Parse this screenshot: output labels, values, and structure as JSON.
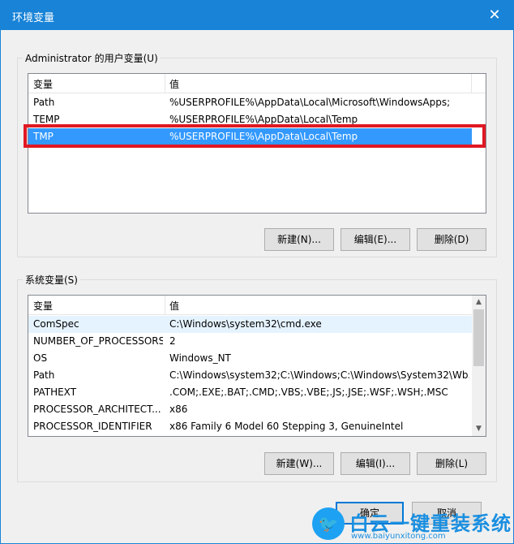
{
  "window": {
    "title": "环境变量",
    "close_glyph": "✕"
  },
  "user_vars": {
    "label": "Administrator 的用户变量(U)",
    "columns": [
      "变量",
      "值"
    ],
    "rows": [
      {
        "name": "Path",
        "value": "%USERPROFILE%\\AppData\\Local\\Microsoft\\WindowsApps;"
      },
      {
        "name": "TEMP",
        "value": "%USERPROFILE%\\AppData\\Local\\Temp"
      },
      {
        "name": "TMP",
        "value": "%USERPROFILE%\\AppData\\Local\\Temp",
        "selected": true
      }
    ],
    "buttons": {
      "new": "新建(N)...",
      "edit": "编辑(E)...",
      "delete": "删除(D)"
    }
  },
  "system_vars": {
    "label": "系统变量(S)",
    "columns": [
      "变量",
      "值"
    ],
    "rows": [
      {
        "name": "ComSpec",
        "value": "C:\\Windows\\system32\\cmd.exe"
      },
      {
        "name": "NUMBER_OF_PROCESSORS",
        "value": "2"
      },
      {
        "name": "OS",
        "value": "Windows_NT"
      },
      {
        "name": "Path",
        "value": "C:\\Windows\\system32;C:\\Windows;C:\\Windows\\System32\\Wb..."
      },
      {
        "name": "PATHEXT",
        "value": ".COM;.EXE;.BAT;.CMD;.VBS;.VBE;.JS;.JSE;.WSF;.WSH;.MSC"
      },
      {
        "name": "PROCESSOR_ARCHITECT...",
        "value": "x86"
      },
      {
        "name": "PROCESSOR_IDENTIFIER",
        "value": "x86 Family 6 Model 60 Stepping 3, GenuineIntel"
      }
    ],
    "buttons": {
      "new": "新建(W)...",
      "edit": "编辑(I)...",
      "delete": "删除(L)"
    }
  },
  "footer": {
    "ok": "确定",
    "cancel": "取消"
  },
  "watermark": {
    "brand": "白云一键重装系统",
    "url": "www.baiyunxitong.com"
  },
  "colors": {
    "titlebar": "#1883d7",
    "selection": "#3399ff",
    "highlight": "#e01822"
  }
}
